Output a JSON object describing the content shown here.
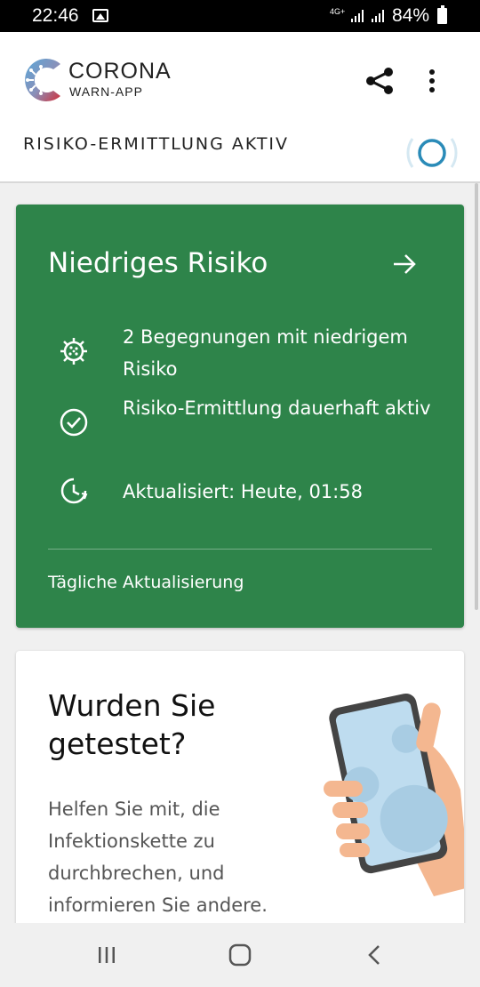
{
  "status_bar": {
    "time": "22:46",
    "network": "4G+",
    "battery": "84%",
    "icons": [
      "gallery-icon",
      "signal-icon",
      "signal-icon",
      "battery-icon"
    ]
  },
  "app_bar": {
    "brand_line1": "CORONA",
    "brand_line2": "WARN-APP",
    "status_text": "RISIKO-ERMITTLUNG AKTIV",
    "icons": [
      "share-icon",
      "more-vert-icon"
    ]
  },
  "risk_card": {
    "title": "Niedriges Risiko",
    "color": "#2e844a",
    "rows": [
      {
        "icon": "virus-icon",
        "text": "2 Begegnungen mit niedrigem Risiko"
      },
      {
        "icon": "check-circle-icon",
        "text": "Risiko-Ermittlung dauerhaft aktiv"
      },
      {
        "icon": "clock-refresh-icon",
        "text": "Aktualisiert: Heute, 01:58"
      }
    ],
    "footer": "Tägliche Aktualisierung"
  },
  "test_card": {
    "title": "Wurden Sie getestet?",
    "body": "Helfen Sie mit, die Infektionskette zu durchbrechen, und informieren Sie andere."
  },
  "nav_bar": {
    "icons": [
      "recent-apps-icon",
      "home-icon",
      "back-icon"
    ]
  }
}
